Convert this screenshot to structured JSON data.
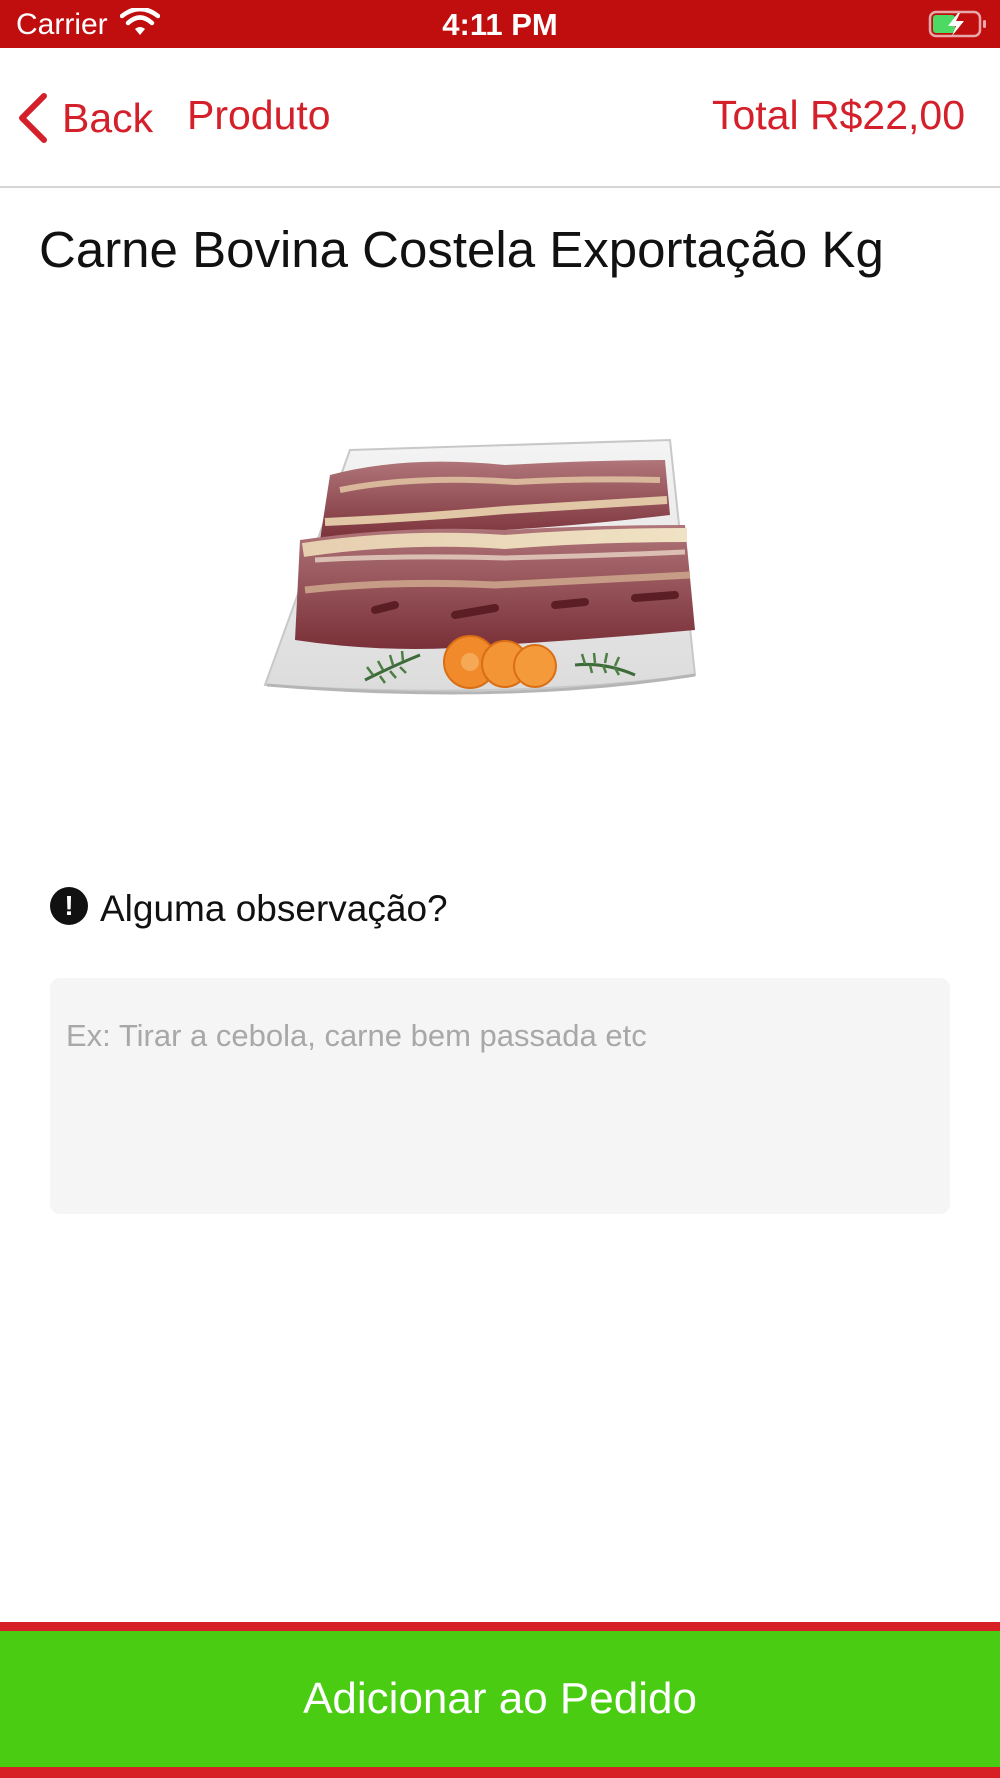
{
  "status_bar": {
    "carrier": "Carrier",
    "time": "4:11 PM",
    "bg_color": "#c00d0d",
    "icons": [
      "wifi-icon",
      "battery-charging-icon"
    ]
  },
  "nav": {
    "back_label": "Back",
    "title": "Produto",
    "total": "Total R$22,00",
    "accent_color": "#d4202a"
  },
  "product": {
    "title": "Carne Bovina Costela Exportação Kg",
    "image_name": "beef-ribs-product-image"
  },
  "observation": {
    "label": "Alguma observação?",
    "icon": "alert-icon",
    "placeholder": "Ex: Tirar a cebola, carne bem passada etc",
    "value": ""
  },
  "footer": {
    "add_label": "Adicionar ao Pedido",
    "button_color": "#49cc12"
  }
}
